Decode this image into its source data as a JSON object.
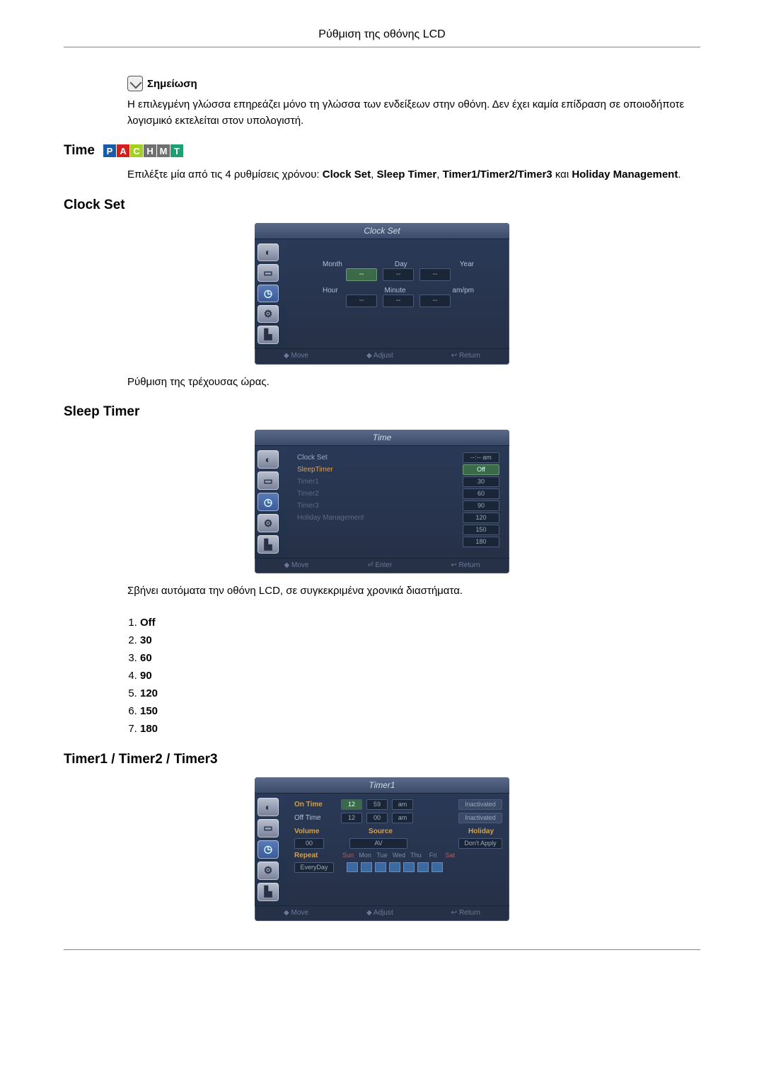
{
  "header": "Ρύθμιση της οθόνης LCD",
  "note": {
    "label": "Σημείωση",
    "text": "Η επιλεγμένη γλώσσα επηρεάζει μόνο τη γλώσσα των ενδείξεων στην οθόνη. Δεν έχει καμία επίδραση σε οποιοδήποτε λογισμικό εκτελείται στον υπολογιστή."
  },
  "time": {
    "title": "Time",
    "badges": [
      {
        "letter": "P",
        "color": "#1a5aa8"
      },
      {
        "letter": "A",
        "color": "#d02020"
      },
      {
        "letter": "C",
        "color": "#a0d020"
      },
      {
        "letter": "H",
        "color": "#707070"
      },
      {
        "letter": "M",
        "color": "#707070"
      },
      {
        "letter": "T",
        "color": "#20a070"
      }
    ],
    "intro_pre": "Επιλέξτε μία από τις 4 ρυθμίσεις χρόνου: ",
    "opt1": "Clock Set",
    "opt2": "Sleep Timer",
    "opt3": "Timer1/Timer2/Timer3",
    "and": " και ",
    "opt4": "Holiday Management",
    "comma": ", "
  },
  "clockset": {
    "title": "Clock Set",
    "osd_title": "Clock Set",
    "labels1": {
      "a": "Month",
      "b": "Day",
      "c": "Year"
    },
    "labels2": {
      "a": "Hour",
      "b": "Minute",
      "c": "am/pm"
    },
    "dash": "--",
    "footer": {
      "a": "◆ Move",
      "b": "◆ Adjust",
      "c": "↩ Return"
    },
    "desc": "Ρύθμιση της τρέχουσας ώρας."
  },
  "sleeptimer": {
    "title": "Sleep Timer",
    "osd_title": "Time",
    "rows": [
      {
        "label": "Clock Set",
        "val": "--:-- am",
        "cls": ""
      },
      {
        "label": "SleepTimer",
        "val": "Off",
        "cls": "active",
        "sel": true
      },
      {
        "label": "Timer1",
        "val": "30",
        "cls": "dim"
      },
      {
        "label": "Timer2",
        "val": "60",
        "cls": "dim"
      },
      {
        "label": "Timer3",
        "val": "90",
        "cls": "dim"
      },
      {
        "label": "Holiday Management",
        "val": "120",
        "cls": "dim"
      },
      {
        "label": "",
        "val": "150",
        "cls": "dim"
      },
      {
        "label": "",
        "val": "180",
        "cls": "dim"
      }
    ],
    "footer": {
      "a": "◆ Move",
      "b": "⏎ Enter",
      "c": "↩ Return"
    },
    "desc": "Σβήνει αυτόματα την οθόνη LCD, σε συγκεκριμένα χρονικά διαστήματα.",
    "options": [
      "Off",
      "30",
      "60",
      "90",
      "120",
      "150",
      "180"
    ]
  },
  "timers": {
    "title": "Timer1 / Timer2 / Timer3",
    "osd_title": "Timer1",
    "ontime": {
      "lbl": "On Time",
      "h": "12",
      "m": "59",
      "ap": "am",
      "state": "Inactivated"
    },
    "offtime": {
      "lbl": "Off Time",
      "h": "12",
      "m": "00",
      "ap": "am",
      "state": "Inactivated"
    },
    "volume": {
      "lbl": "Volume",
      "v": "00"
    },
    "source": {
      "lbl": "Source",
      "v": "AV"
    },
    "holiday": {
      "lbl": "Holiday",
      "v": "Don't Apply"
    },
    "repeat": {
      "lbl": "Repeat",
      "v": "EveryDay"
    },
    "days": [
      "Sun",
      "Mon",
      "Tue",
      "Wed",
      "Thu",
      "Fri",
      "Sat"
    ],
    "footer": {
      "a": "◆ Move",
      "b": "◆ Adjust",
      "c": "↩ Return"
    }
  }
}
